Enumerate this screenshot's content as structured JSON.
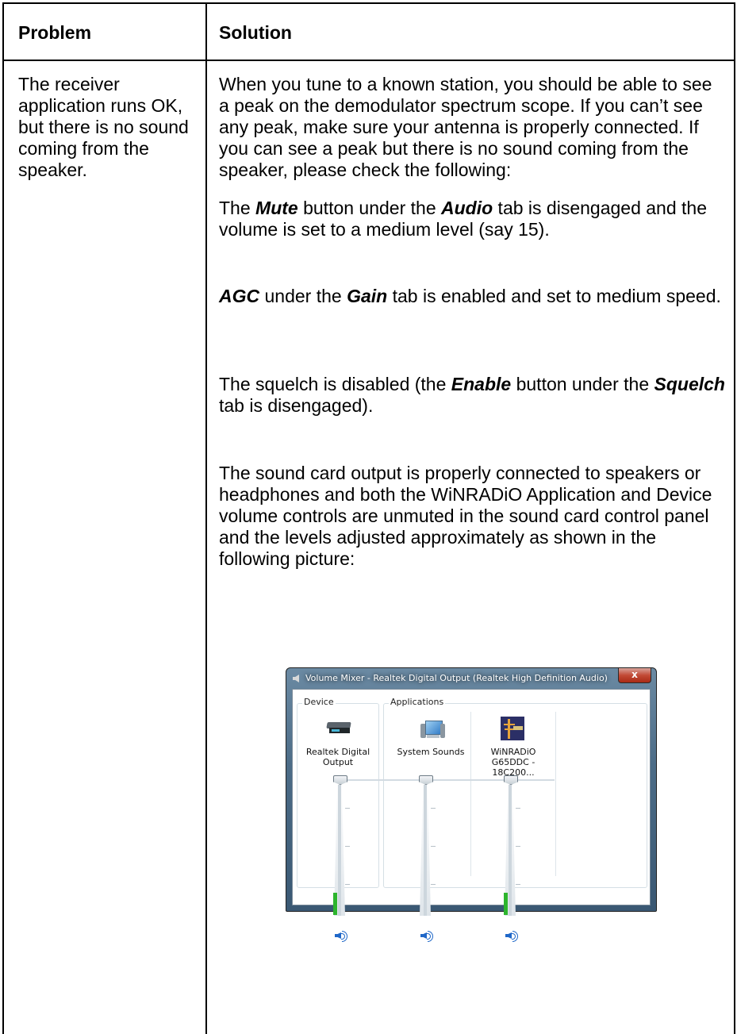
{
  "table": {
    "header": {
      "problem": "Problem",
      "solution": "Solution"
    },
    "problem_text": "The receiver application runs OK, but there is no sound coming from the speaker.",
    "solution": {
      "para1": "When you tune to a known station, you should be able to see a peak on the demodulator spectrum scope. If you can’t see any peak, make sure your antenna is properly connected. If you can see a peak but there is no sound coming from the speaker, please check the following:",
      "para2": {
        "a": "The ",
        "mute": "Mute",
        "b": " button under the ",
        "audio": "Audio",
        "c": " tab is disengaged and the volume is set to a medium level (say 15)."
      },
      "para3": {
        "agc": "AGC",
        "a": " under the ",
        "gain": "Gain",
        "b": " tab is enabled and set to medium speed."
      },
      "para4": {
        "a": "The squelch is disabled (the ",
        "enable": "Enable",
        "b": " button under the ",
        "squelch": "Squelch",
        "c": " tab is disengaged)."
      },
      "para5": "The sound card output is properly connected to speakers or headphones and both the WiNRADiO Application and Device volume controls are unmuted in the sound card control panel and the levels adjusted approximately as shown in the following picture:"
    }
  },
  "volume_mixer": {
    "title": "Volume Mixer - Realtek Digital Output (Realtek High Definition Audio)",
    "close_label": "x",
    "device_group": "Device",
    "applications_group": "Applications",
    "channels": [
      {
        "name_line1": "Realtek Digital",
        "name_line2": "Output",
        "icon": "speaker-device-icon",
        "volume_level": 1.0,
        "meter_level": 0.15
      },
      {
        "name_line1": "System Sounds",
        "name_line2": "",
        "icon": "system-sounds-icon",
        "volume_level": 1.0,
        "meter_level": 0.0
      },
      {
        "name_line1": "WiNRADiO",
        "name_line2": "G65DDC - 18C200...",
        "icon": "winradio-icon",
        "volume_level": 1.0,
        "meter_level": 0.15
      }
    ],
    "accent": "#2db52d"
  }
}
